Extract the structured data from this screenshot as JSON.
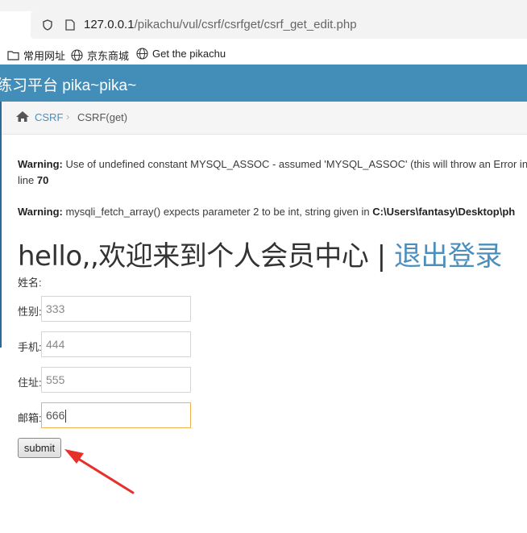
{
  "browser": {
    "url_host": "127.0.0.1",
    "url_path": "/pikachu/vul/csrf/csrfget/csrf_get_edit.php",
    "bookmarks": [
      {
        "label": "常用网址",
        "icon": "folder-icon"
      },
      {
        "label": "京东商城",
        "icon": "globe-icon"
      },
      {
        "label": "Get the pikachu",
        "icon": "globe-icon"
      }
    ]
  },
  "header": {
    "title": "练习平台 pika~pika~"
  },
  "breadcrumb": {
    "link": "CSRF",
    "current": "CSRF(get)"
  },
  "warnings": [
    {
      "label": "Warning:",
      "text": " Use of undefined constant MYSQL_ASSOC - assumed 'MYSQL_ASSOC' (this will throw an Error in",
      "line_prefix": "line ",
      "line_no": "70"
    },
    {
      "label": "Warning:",
      "text": " mysqli_fetch_array() expects parameter 2 to be int, string given in ",
      "path": "C:\\Users\\fantasy\\Desktop\\ph"
    }
  ],
  "main": {
    "greeting": "hello,,欢迎来到个人会员中心 | ",
    "logout": "退出登录",
    "name_label": "姓名:",
    "fields": [
      {
        "label": "性别:",
        "value": "333"
      },
      {
        "label": "手机:",
        "value": "444"
      },
      {
        "label": "住址:",
        "value": "555"
      },
      {
        "label": "邮箱:",
        "value": "666"
      }
    ],
    "submit_label": "submit"
  },
  "colors": {
    "header_bg": "#438eb9",
    "link": "#4c8fbd",
    "focus_border": "#f5b14e",
    "annotation_arrow": "#e8302a"
  }
}
